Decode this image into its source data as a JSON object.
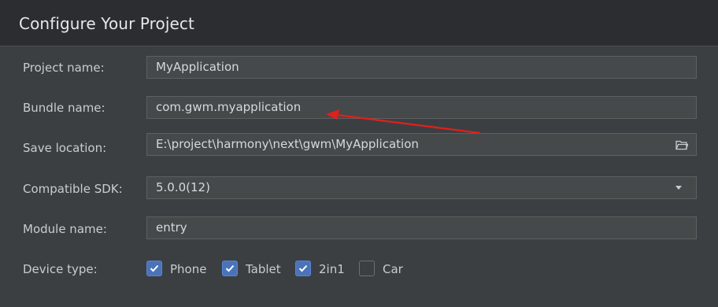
{
  "title": "Configure Your Project",
  "form": {
    "project_name": {
      "label": "Project name:",
      "value": "MyApplication"
    },
    "bundle_name": {
      "label": "Bundle name:",
      "value": "com.gwm.myapplication"
    },
    "save_location": {
      "label": "Save location:",
      "value": "E:\\project\\harmony\\next\\gwm\\MyApplication",
      "icon": "folder-open-icon"
    },
    "compatible_sdk": {
      "label": "Compatible SDK:",
      "value": "5.0.0(12)",
      "icon": "chevron-down-icon"
    },
    "module_name": {
      "label": "Module name:",
      "value": "entry"
    },
    "device_type": {
      "label": "Device type:",
      "options": [
        {
          "label": "Phone",
          "checked": true
        },
        {
          "label": "Tablet",
          "checked": true
        },
        {
          "label": "2in1",
          "checked": true
        },
        {
          "label": "Car",
          "checked": false
        }
      ]
    }
  },
  "annotation": {
    "type": "arrow",
    "color": "#e0201c",
    "points_to": "bundle_name"
  },
  "colors": {
    "background": "#2b2d30",
    "panel": "#3c3f41",
    "field": "#45494a",
    "checkbox_checked": "#4a73b9",
    "arrow": "#e0201c"
  }
}
